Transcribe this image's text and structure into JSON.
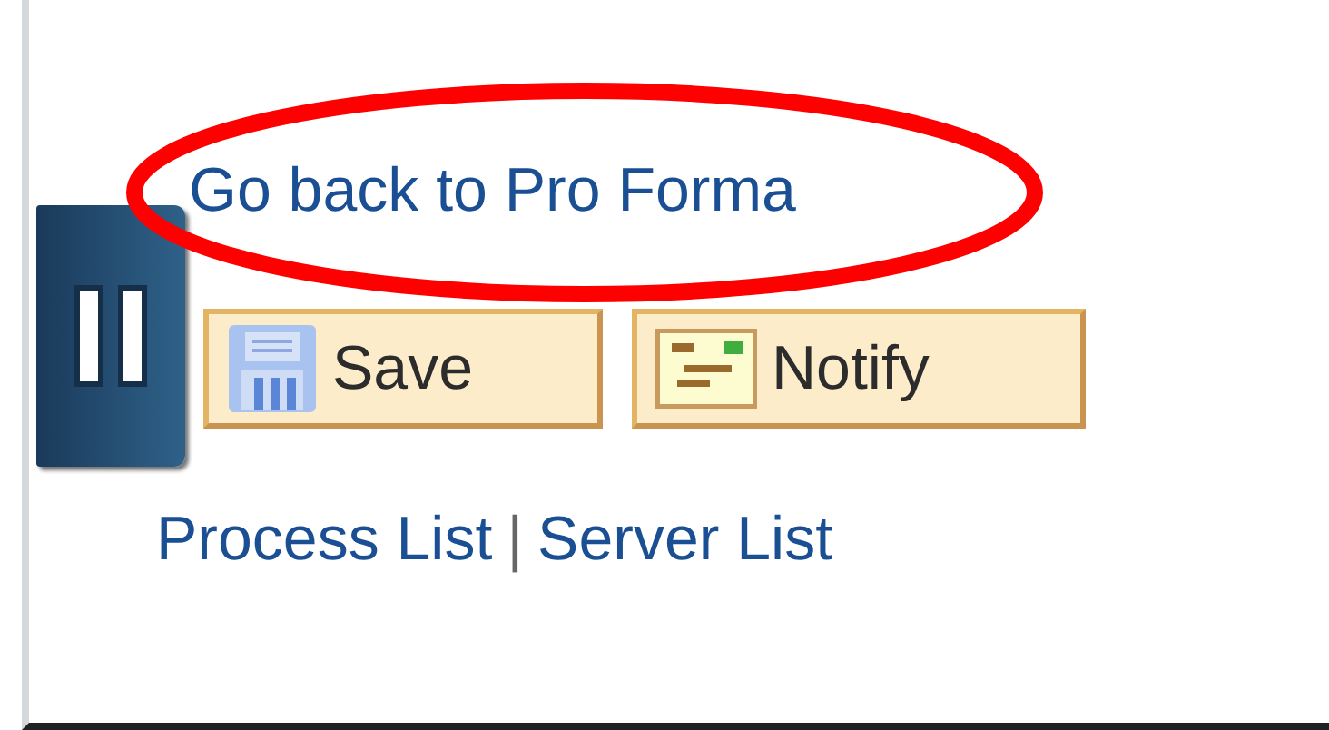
{
  "back_link": "Go back to Pro Forma",
  "buttons": [
    {
      "label": "Save",
      "kind": "save"
    },
    {
      "label": "Notify",
      "kind": "notify"
    }
  ],
  "footer_links": [
    "Process List",
    "Server List"
  ],
  "footer_separator": "|",
  "annotation": {
    "kind": "ellipse",
    "color": "#ff0000"
  }
}
